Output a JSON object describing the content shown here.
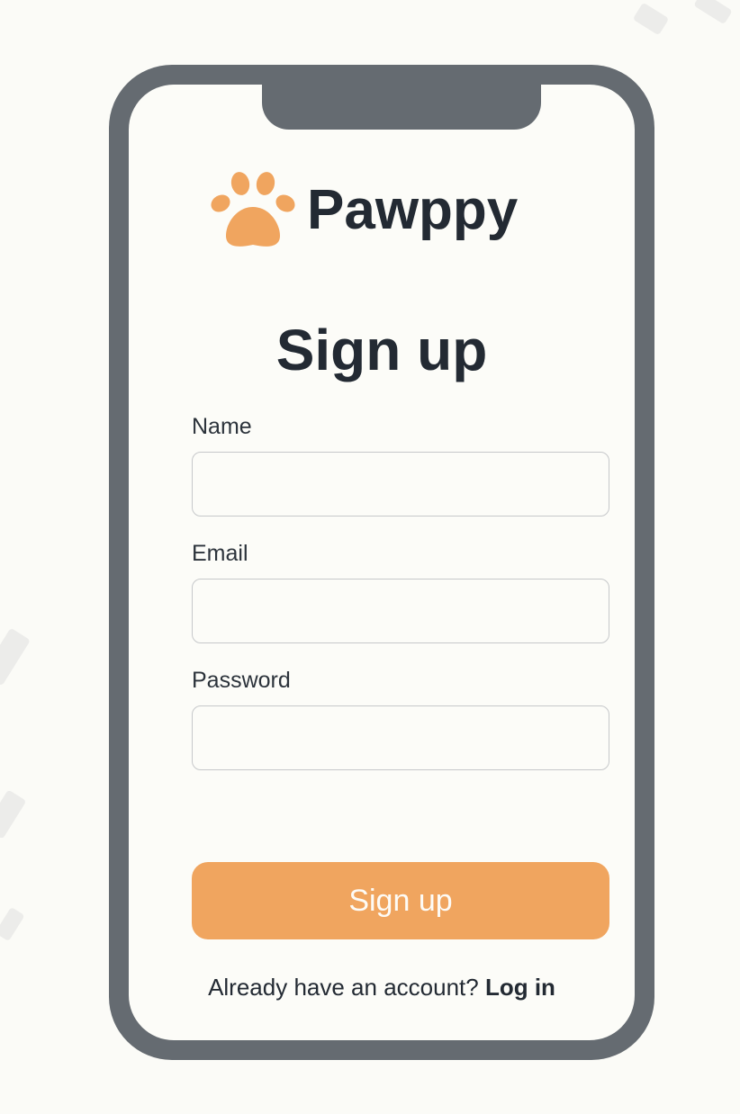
{
  "brand": {
    "name": "Pawppy",
    "logo_icon": "paw-icon",
    "logo_color": "#f0a55f"
  },
  "page": {
    "title": "Sign up"
  },
  "form": {
    "name_label": "Name",
    "name_value": "",
    "email_label": "Email",
    "email_value": "",
    "password_label": "Password",
    "password_value": "",
    "submit_label": "Sign up",
    "submit_color": "#f0a55f"
  },
  "footer": {
    "prompt": "Already have an account?",
    "login_label": "Log in"
  }
}
